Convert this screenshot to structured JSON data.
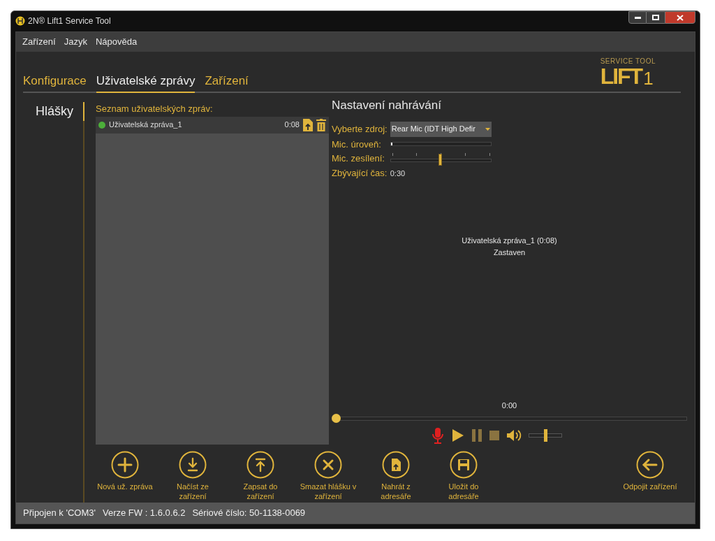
{
  "window": {
    "title": "2N® Lift1 Service Tool"
  },
  "menu": [
    "Zařízení",
    "Jazyk",
    "Nápověda"
  ],
  "logo": {
    "top": "SERVICE TOOL",
    "main": "LIFT",
    "suffix": "1"
  },
  "tabs": [
    {
      "label": "Konfigurace",
      "selected": false
    },
    {
      "label": "Uživatelské zprávy",
      "selected": true
    },
    {
      "label": "Zařízení",
      "selected": false
    }
  ],
  "sidebar": {
    "items": [
      {
        "label": "Hlášky",
        "selected": true
      }
    ]
  },
  "message_list": {
    "title": "Seznam uživatelských zpráv:",
    "items": [
      {
        "name": "Uživatelská zpráva_1",
        "color": "#4caf3a",
        "duration": "0:08"
      }
    ]
  },
  "recording": {
    "title": "Nastavení nahrávání",
    "source_label": "Vyberte zdroj:",
    "source_value": "Rear Mic (IDT High Defir",
    "mic_level_label": "Mic. úroveň:",
    "mic_level": {
      "level": 0.01
    },
    "gain_label": "Mic. zesílení:",
    "gain": {
      "level": 0.5
    },
    "remaining_label": "Zbývající čas:",
    "remaining_value": "0:30"
  },
  "player": {
    "message": "Uživatelská zpráva_1 (0:08)",
    "state": "Zastaven",
    "time": "0:00",
    "progress": {
      "level": 0
    },
    "controls": [
      {
        "kind": "record",
        "disabled": false
      },
      {
        "kind": "play",
        "disabled": false
      },
      {
        "kind": "pause",
        "disabled": true
      },
      {
        "kind": "stop",
        "disabled": true
      },
      {
        "kind": "volume",
        "disabled": false
      }
    ],
    "volume": {
      "level": 0.5
    }
  },
  "actions": [
    {
      "kind": "add",
      "label": "Nová už. zpráva"
    },
    {
      "kind": "download",
      "label": "Načíst ze zařízení"
    },
    {
      "kind": "upload",
      "label": "Zapsat do zařízení"
    },
    {
      "kind": "delete",
      "label": "Smazat hlášku v zařízení"
    },
    {
      "kind": "file",
      "label": "Nahrát z adresáře"
    },
    {
      "kind": "save",
      "label": "Uložit do adresáře"
    }
  ],
  "disconnect": {
    "kind": "back",
    "label": "Odpojit zařízení"
  },
  "status_bar": [
    "Připojen k 'COM3'",
    "Verze FW : 1.6.0.6.2",
    "Sériové číslo: 50-1138-0069"
  ]
}
